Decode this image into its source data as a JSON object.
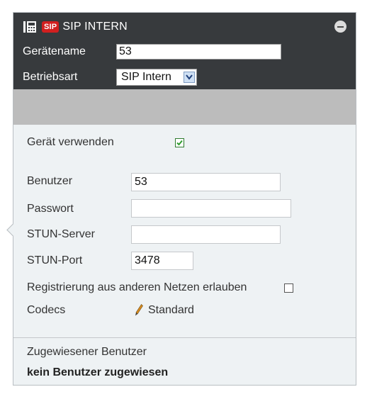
{
  "header": {
    "badge": "SIP",
    "title": "SIP INTERN",
    "device_name_label": "Gerätename",
    "device_name_value": "53",
    "mode_label": "Betriebsart",
    "mode_value": "SIP Intern"
  },
  "settings": {
    "use_device_label": "Gerät verwenden",
    "use_device_checked": true,
    "user_label": "Benutzer",
    "user_value": "53",
    "password_label": "Passwort",
    "password_value": "",
    "stun_server_label": "STUN-Server",
    "stun_server_value": "",
    "stun_port_label": "STUN-Port",
    "stun_port_value": "3478",
    "allow_other_networks_label": "Registrierung aus anderen Netzen erlauben",
    "allow_other_networks_checked": false,
    "codecs_label": "Codecs",
    "codecs_value": "Standard"
  },
  "assignment": {
    "label": "Zugewiesener Benutzer",
    "value": "kein Benutzer zugewiesen"
  },
  "icons": [
    "device-icon",
    "sip-badge",
    "collapse-icon",
    "checkmark-icon",
    "dropdown-arrow-icon",
    "pencil-icon"
  ],
  "colors": {
    "header_bg": "#373a3d",
    "band_bg": "#bcbcbc",
    "panel_bg": "#eef2f4",
    "badge_red": "#d21f1f",
    "check_green": "#2f9b2f"
  }
}
